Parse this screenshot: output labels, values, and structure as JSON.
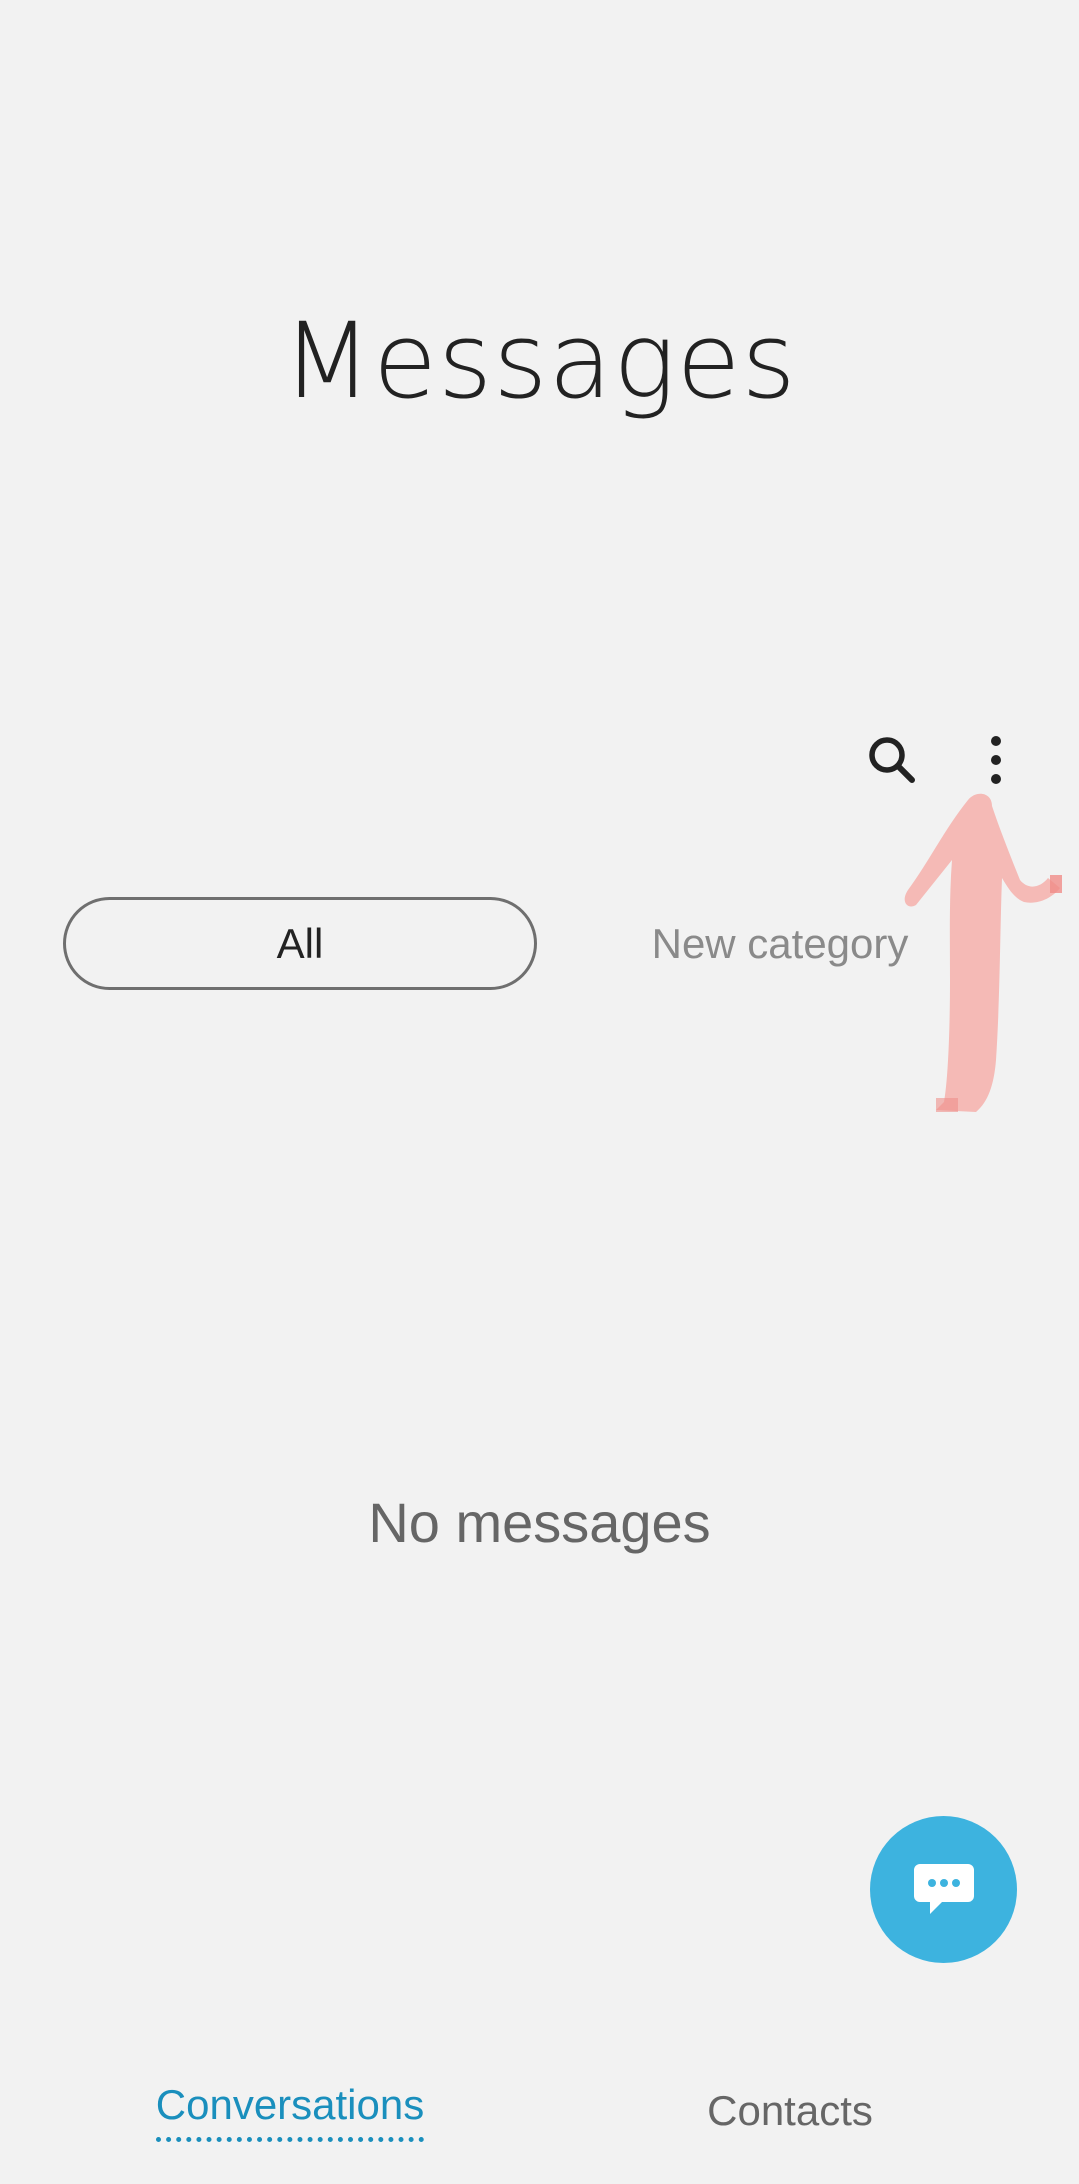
{
  "header": {
    "title": "Messages"
  },
  "toolbar": {
    "search_icon": "search-icon",
    "more_icon": "more-options-icon"
  },
  "categories": {
    "items": [
      {
        "label": "All",
        "selected": true
      },
      {
        "label": "New category",
        "selected": false
      }
    ]
  },
  "empty_state": {
    "text": "No messages"
  },
  "fab": {
    "icon": "new-message-icon",
    "color": "#3db3df"
  },
  "bottom_tabs": {
    "items": [
      {
        "label": "Conversations",
        "selected": true
      },
      {
        "label": "Contacts",
        "selected": false
      }
    ]
  },
  "colors": {
    "accent": "#1a8fbd",
    "background": "#f2f2f2",
    "annotation": "#f4b6b2"
  }
}
